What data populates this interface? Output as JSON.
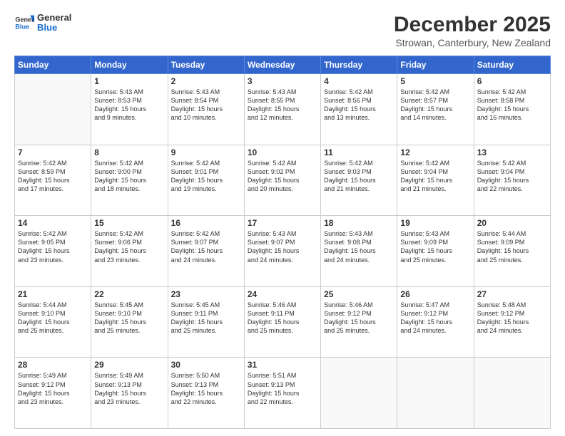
{
  "header": {
    "logo_general": "General",
    "logo_blue": "Blue",
    "month_title": "December 2025",
    "location": "Strowan, Canterbury, New Zealand"
  },
  "weekdays": [
    "Sunday",
    "Monday",
    "Tuesday",
    "Wednesday",
    "Thursday",
    "Friday",
    "Saturday"
  ],
  "weeks": [
    [
      {
        "day": "",
        "info": ""
      },
      {
        "day": "1",
        "info": "Sunrise: 5:43 AM\nSunset: 8:53 PM\nDaylight: 15 hours\nand 9 minutes."
      },
      {
        "day": "2",
        "info": "Sunrise: 5:43 AM\nSunset: 8:54 PM\nDaylight: 15 hours\nand 10 minutes."
      },
      {
        "day": "3",
        "info": "Sunrise: 5:43 AM\nSunset: 8:55 PM\nDaylight: 15 hours\nand 12 minutes."
      },
      {
        "day": "4",
        "info": "Sunrise: 5:42 AM\nSunset: 8:56 PM\nDaylight: 15 hours\nand 13 minutes."
      },
      {
        "day": "5",
        "info": "Sunrise: 5:42 AM\nSunset: 8:57 PM\nDaylight: 15 hours\nand 14 minutes."
      },
      {
        "day": "6",
        "info": "Sunrise: 5:42 AM\nSunset: 8:58 PM\nDaylight: 15 hours\nand 16 minutes."
      }
    ],
    [
      {
        "day": "7",
        "info": "Sunrise: 5:42 AM\nSunset: 8:59 PM\nDaylight: 15 hours\nand 17 minutes."
      },
      {
        "day": "8",
        "info": "Sunrise: 5:42 AM\nSunset: 9:00 PM\nDaylight: 15 hours\nand 18 minutes."
      },
      {
        "day": "9",
        "info": "Sunrise: 5:42 AM\nSunset: 9:01 PM\nDaylight: 15 hours\nand 19 minutes."
      },
      {
        "day": "10",
        "info": "Sunrise: 5:42 AM\nSunset: 9:02 PM\nDaylight: 15 hours\nand 20 minutes."
      },
      {
        "day": "11",
        "info": "Sunrise: 5:42 AM\nSunset: 9:03 PM\nDaylight: 15 hours\nand 21 minutes."
      },
      {
        "day": "12",
        "info": "Sunrise: 5:42 AM\nSunset: 9:04 PM\nDaylight: 15 hours\nand 21 minutes."
      },
      {
        "day": "13",
        "info": "Sunrise: 5:42 AM\nSunset: 9:04 PM\nDaylight: 15 hours\nand 22 minutes."
      }
    ],
    [
      {
        "day": "14",
        "info": "Sunrise: 5:42 AM\nSunset: 9:05 PM\nDaylight: 15 hours\nand 23 minutes."
      },
      {
        "day": "15",
        "info": "Sunrise: 5:42 AM\nSunset: 9:06 PM\nDaylight: 15 hours\nand 23 minutes."
      },
      {
        "day": "16",
        "info": "Sunrise: 5:42 AM\nSunset: 9:07 PM\nDaylight: 15 hours\nand 24 minutes."
      },
      {
        "day": "17",
        "info": "Sunrise: 5:43 AM\nSunset: 9:07 PM\nDaylight: 15 hours\nand 24 minutes."
      },
      {
        "day": "18",
        "info": "Sunrise: 5:43 AM\nSunset: 9:08 PM\nDaylight: 15 hours\nand 24 minutes."
      },
      {
        "day": "19",
        "info": "Sunrise: 5:43 AM\nSunset: 9:09 PM\nDaylight: 15 hours\nand 25 minutes."
      },
      {
        "day": "20",
        "info": "Sunrise: 5:44 AM\nSunset: 9:09 PM\nDaylight: 15 hours\nand 25 minutes."
      }
    ],
    [
      {
        "day": "21",
        "info": "Sunrise: 5:44 AM\nSunset: 9:10 PM\nDaylight: 15 hours\nand 25 minutes."
      },
      {
        "day": "22",
        "info": "Sunrise: 5:45 AM\nSunset: 9:10 PM\nDaylight: 15 hours\nand 25 minutes."
      },
      {
        "day": "23",
        "info": "Sunrise: 5:45 AM\nSunset: 9:11 PM\nDaylight: 15 hours\nand 25 minutes."
      },
      {
        "day": "24",
        "info": "Sunrise: 5:46 AM\nSunset: 9:11 PM\nDaylight: 15 hours\nand 25 minutes."
      },
      {
        "day": "25",
        "info": "Sunrise: 5:46 AM\nSunset: 9:12 PM\nDaylight: 15 hours\nand 25 minutes."
      },
      {
        "day": "26",
        "info": "Sunrise: 5:47 AM\nSunset: 9:12 PM\nDaylight: 15 hours\nand 24 minutes."
      },
      {
        "day": "27",
        "info": "Sunrise: 5:48 AM\nSunset: 9:12 PM\nDaylight: 15 hours\nand 24 minutes."
      }
    ],
    [
      {
        "day": "28",
        "info": "Sunrise: 5:49 AM\nSunset: 9:12 PM\nDaylight: 15 hours\nand 23 minutes."
      },
      {
        "day": "29",
        "info": "Sunrise: 5:49 AM\nSunset: 9:13 PM\nDaylight: 15 hours\nand 23 minutes."
      },
      {
        "day": "30",
        "info": "Sunrise: 5:50 AM\nSunset: 9:13 PM\nDaylight: 15 hours\nand 22 minutes."
      },
      {
        "day": "31",
        "info": "Sunrise: 5:51 AM\nSunset: 9:13 PM\nDaylight: 15 hours\nand 22 minutes."
      },
      {
        "day": "",
        "info": ""
      },
      {
        "day": "",
        "info": ""
      },
      {
        "day": "",
        "info": ""
      }
    ]
  ]
}
